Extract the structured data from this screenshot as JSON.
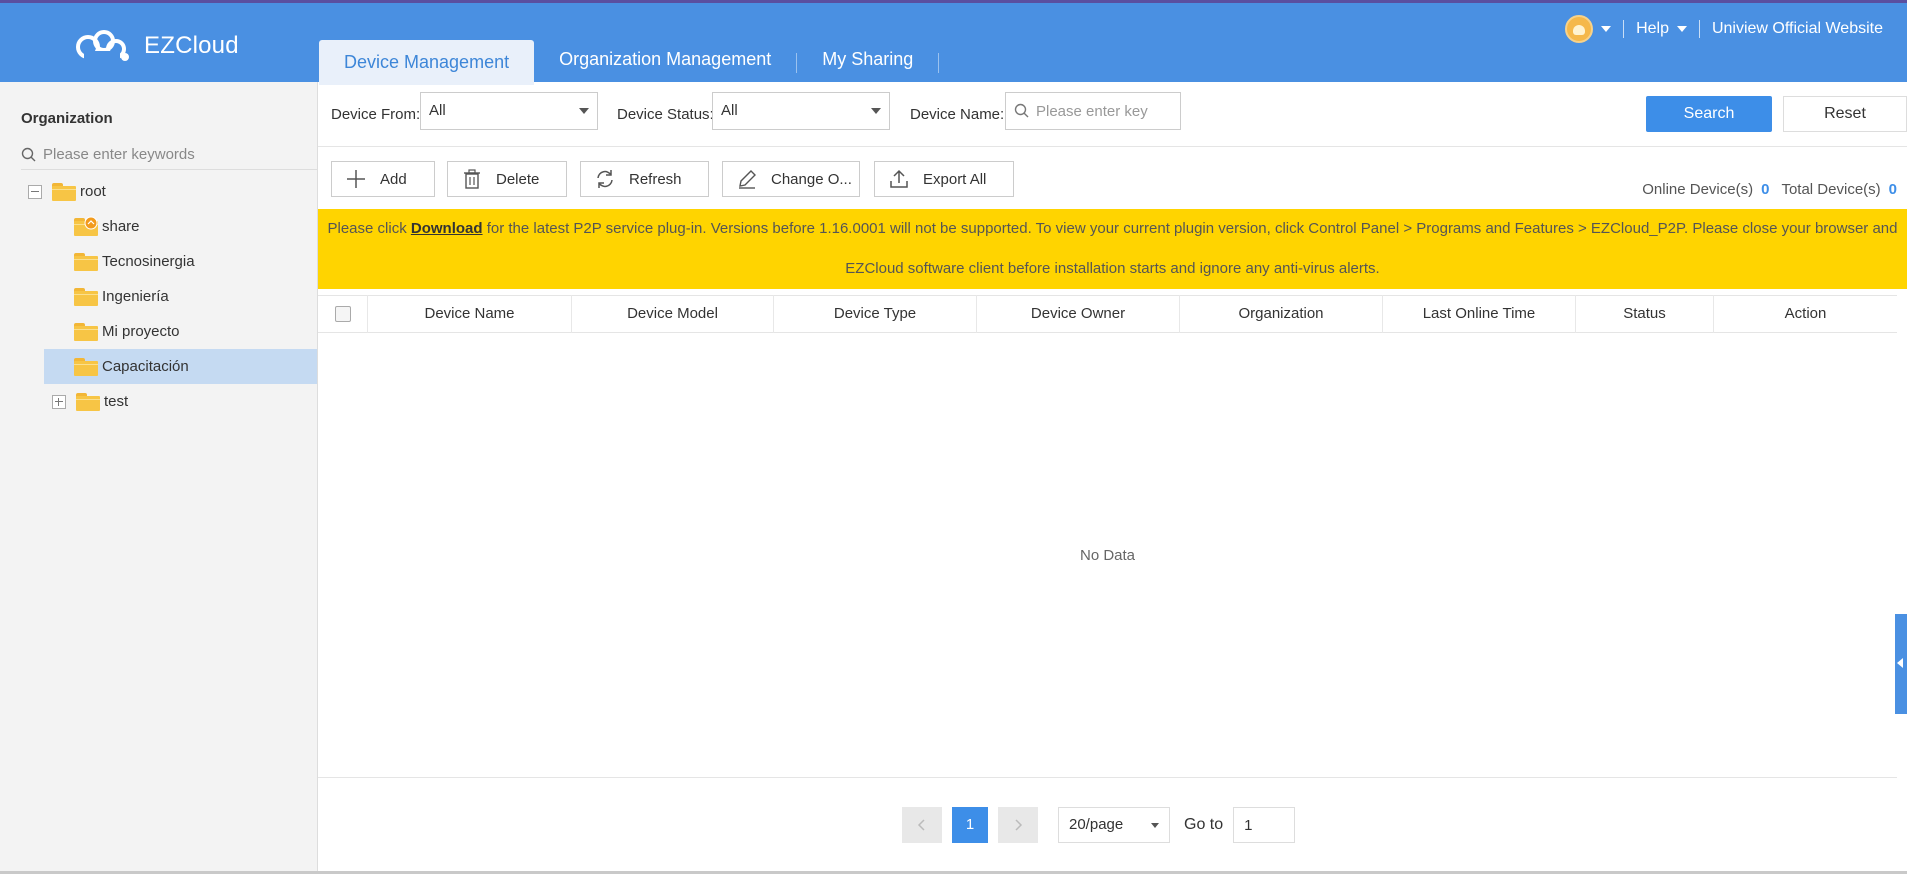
{
  "header": {
    "logo_text": "EZCloud",
    "tabs": [
      {
        "label": "Device Management",
        "active": true
      },
      {
        "label": "Organization Management",
        "active": false
      },
      {
        "label": "My Sharing",
        "active": false
      }
    ],
    "help_label": "Help",
    "official_link": "Uniview Official Website"
  },
  "sidebar": {
    "title": "Organization",
    "search_placeholder": "Please enter keywords",
    "tree": [
      {
        "label": "root"
      },
      {
        "label": "share"
      },
      {
        "label": "Tecnosinergia"
      },
      {
        "label": "Ingeniería"
      },
      {
        "label": "Mi proyecto"
      },
      {
        "label": "Capacitación"
      },
      {
        "label": "test"
      }
    ]
  },
  "filters": {
    "device_from_label": "Device From:",
    "device_from_value": "All",
    "device_status_label": "Device Status:",
    "device_status_value": "All",
    "device_name_label": "Device Name:",
    "device_name_placeholder": "Please enter key",
    "search_label": "Search",
    "reset_label": "Reset"
  },
  "toolbar": {
    "add": "Add",
    "delete": "Delete",
    "refresh": "Refresh",
    "change_owner": "Change O...",
    "export_all": "Export All",
    "online_label": "Online Device(s)",
    "online_count": "0",
    "total_label": "Total Device(s)",
    "total_count": "0"
  },
  "notice": {
    "prefix": "Please click ",
    "link": "Download",
    "rest_line1": " for the latest P2P service plug-in. Versions before 1.16.0001 will not be supported. To view your current plugin version, click Control Panel > Programs and Features > EZCloud_P2P. Please close your browser and",
    "line2": "EZCloud software client before installation starts and ignore any anti-virus alerts."
  },
  "table": {
    "columns": [
      "Device Name",
      "Device Model",
      "Device Type",
      "Device Owner",
      "Organization",
      "Last Online Time",
      "Status",
      "Action"
    ],
    "empty_text": "No Data"
  },
  "pagination": {
    "current_page": "1",
    "page_size": "20/page",
    "goto_label": "Go to",
    "goto_value": "1"
  },
  "colors": {
    "header_bg": "#4a90e2",
    "accent": "#3d8ee8",
    "notice_bg": "#ffd400",
    "folder": "#f7c545",
    "selected_row": "#c5daf2"
  }
}
